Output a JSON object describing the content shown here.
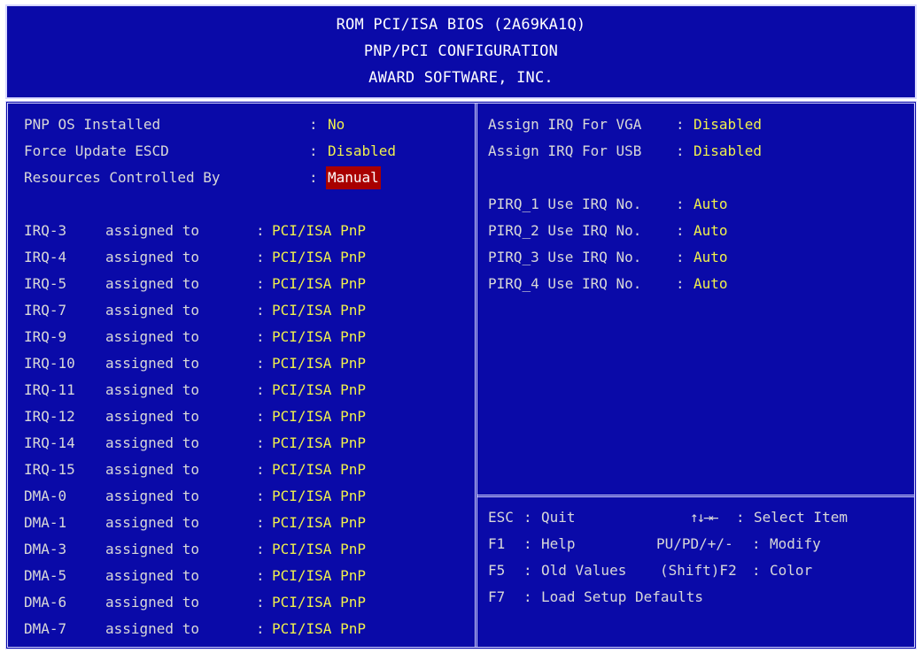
{
  "header": {
    "line1": "ROM PCI/ISA BIOS (2A69KA1Q)",
    "line2": "PNP/PCI CONFIGURATION",
    "line3": "AWARD SOFTWARE, INC."
  },
  "left": {
    "top_settings": [
      {
        "label": "PNP OS Installed",
        "value": "No"
      },
      {
        "label": "Force Update ESCD",
        "value": "Disabled"
      },
      {
        "label": "Resources Controlled By",
        "value": "Manual"
      }
    ],
    "assignments": [
      {
        "name": "IRQ-3",
        "text": "assigned to",
        "value": "PCI/ISA PnP"
      },
      {
        "name": "IRQ-4",
        "text": "assigned to",
        "value": "PCI/ISA PnP"
      },
      {
        "name": "IRQ-5",
        "text": "assigned to",
        "value": "PCI/ISA PnP"
      },
      {
        "name": "IRQ-7",
        "text": "assigned to",
        "value": "PCI/ISA PnP"
      },
      {
        "name": "IRQ-9",
        "text": "assigned to",
        "value": "PCI/ISA PnP"
      },
      {
        "name": "IRQ-10",
        "text": "assigned to",
        "value": "PCI/ISA PnP"
      },
      {
        "name": "IRQ-11",
        "text": "assigned to",
        "value": "PCI/ISA PnP"
      },
      {
        "name": "IRQ-12",
        "text": "assigned to",
        "value": "PCI/ISA PnP"
      },
      {
        "name": "IRQ-14",
        "text": "assigned to",
        "value": "PCI/ISA PnP"
      },
      {
        "name": "IRQ-15",
        "text": "assigned to",
        "value": "PCI/ISA PnP"
      },
      {
        "name": "DMA-0",
        "text": "assigned to",
        "value": "PCI/ISA PnP"
      },
      {
        "name": "DMA-1",
        "text": "assigned to",
        "value": "PCI/ISA PnP"
      },
      {
        "name": "DMA-3",
        "text": "assigned to",
        "value": "PCI/ISA PnP"
      },
      {
        "name": "DMA-5",
        "text": "assigned to",
        "value": "PCI/ISA PnP"
      },
      {
        "name": "DMA-6",
        "text": "assigned to",
        "value": "PCI/ISA PnP"
      },
      {
        "name": "DMA-7",
        "text": "assigned to",
        "value": "PCI/ISA PnP"
      }
    ]
  },
  "right": {
    "assign": [
      {
        "label": "Assign IRQ For VGA",
        "value": "Disabled"
      },
      {
        "label": "Assign IRQ For USB",
        "value": "Disabled"
      }
    ],
    "pirq": [
      {
        "label": "PIRQ_1 Use IRQ No.",
        "value": "Auto"
      },
      {
        "label": "PIRQ_2 Use IRQ No.",
        "value": "Auto"
      },
      {
        "label": "PIRQ_3 Use IRQ No.",
        "value": "Auto"
      },
      {
        "label": "PIRQ_4 Use IRQ No.",
        "value": "Auto"
      }
    ]
  },
  "keys": {
    "esc": {
      "key": "ESC",
      "desc": "Quit"
    },
    "f1": {
      "key": "F1",
      "desc": "Help"
    },
    "f5": {
      "key": "F5",
      "desc": "Old Values"
    },
    "f7": {
      "key": "F7",
      "desc": "Load Setup Defaults"
    },
    "arrows": {
      "key": "↑↓→←",
      "desc": "Select Item"
    },
    "pupd": {
      "key": "PU/PD/+/-",
      "desc": "Modify"
    },
    "shiftf2": {
      "key": "(Shift)F2",
      "desc": "Color"
    }
  },
  "colon": ":",
  "colors": {
    "background": "#0a0aa8",
    "text": "#d8d8d8",
    "value": "#f0f04c",
    "selected_bg": "#a80000"
  }
}
